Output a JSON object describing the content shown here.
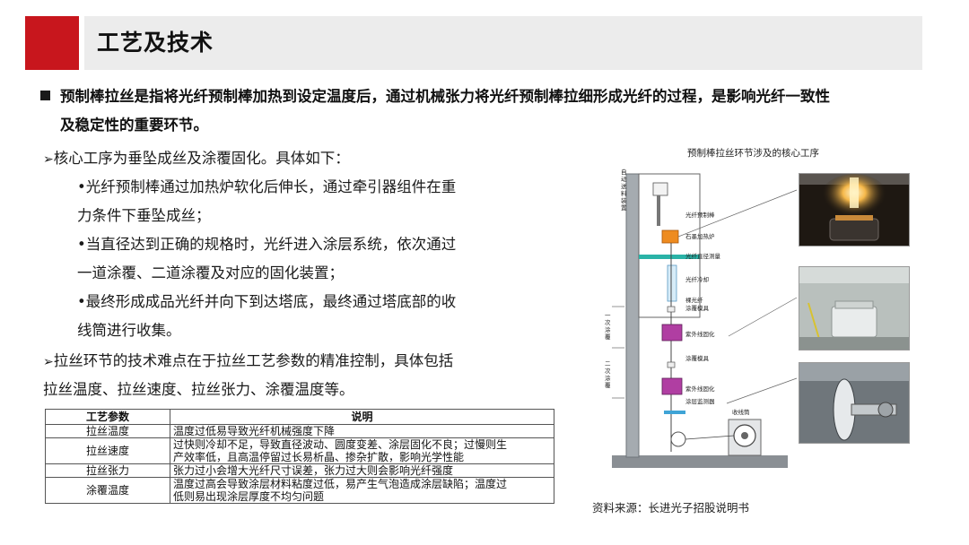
{
  "page_title": "工艺及技术",
  "intro": {
    "line1": "预制棒拉丝是指将光纤预制棒加热到设定温度后，通过机械张力将光纤预制棒拉细形成光纤的过程，是影响光纤一致性",
    "line2": "及稳定性的重要环节。"
  },
  "core": {
    "heading": "核心工序为垂坠成丝及涂覆固化。具体如下：",
    "items": [
      {
        "line1": "•光纤预制棒通过加热炉软化后伸长，通过牵引器组件在重",
        "line2": "力条件下垂坠成丝；"
      },
      {
        "line1": "•当直径达到正确的规格时，光纤进入涂层系统，依次通过",
        "line2": "一道涂覆、二道涂覆及对应的固化装置；"
      },
      {
        "line1": "•最终形成成品光纤并向下到达塔底，最终通过塔底部的收",
        "line2": "线筒进行收集。"
      }
    ]
  },
  "difficulty": {
    "line1": "拉丝环节的技术难点在于拉丝工艺参数的精准控制，具体包括",
    "line2": "拉丝温度、拉丝速度、拉丝张力、涂覆温度等。"
  },
  "table": {
    "headers": [
      "工艺参数",
      "说明"
    ],
    "rows": [
      {
        "param": "拉丝温度",
        "desc": [
          "温度过低易导致光纤机械强度下降"
        ]
      },
      {
        "param": "拉丝速度",
        "desc": [
          "过快则冷却不足，导致直径波动、圆度变差、涂层固化不良；过慢则生",
          "产效率低，且高温停留过长易析晶、掺杂扩散，影响光学性能"
        ]
      },
      {
        "param": "拉丝张力",
        "desc": [
          "张力过小会增大光纤尺寸误差，张力过大则会影响光纤强度"
        ]
      },
      {
        "param": "涂覆温度",
        "desc": [
          "温度过高会导致涂层材料粘度过低，易产生气泡造成涂层缺陷；温度过",
          "低则易出现涂层厚度不均匀问题"
        ]
      }
    ]
  },
  "diagram": {
    "title": "预制棒拉丝环节涉及的核心工序",
    "side_label_1": [
      "自",
      "动",
      "送",
      "料",
      "装",
      "置"
    ],
    "side_label_2": [
      "一",
      "次",
      "涂",
      "覆"
    ],
    "side_label_3": [
      "二",
      "次",
      "涂",
      "覆"
    ],
    "labels": {
      "preform": "光纤预制棒",
      "furnace": "石墨加热炉",
      "diameter": "光纤直径测量",
      "cooling": "光纤冷却",
      "bare": "裸光纤",
      "die1": "涂覆模具",
      "uv1": "紫外线固化",
      "die2": "涂覆模具",
      "uv2": "紫外线固化",
      "monitor": "涂层监测器",
      "spool": "收线筒"
    }
  },
  "source": "资料来源：长进光子招股说明书",
  "colors": {
    "accent_red": "#c8161d",
    "title_bar": "#ececec"
  }
}
